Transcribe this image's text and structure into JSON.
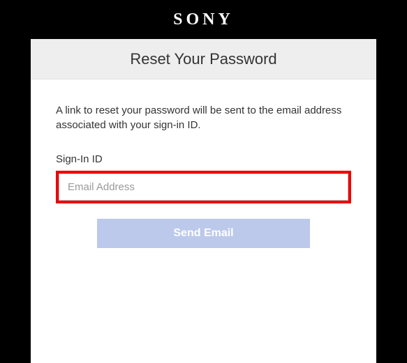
{
  "header": {
    "logo": "SONY"
  },
  "titleBar": {
    "title": "Reset Your Password"
  },
  "content": {
    "description": "A link to reset your password will be sent to the email address associated with your sign-in ID.",
    "fieldLabel": "Sign-In ID",
    "emailPlaceholder": "Email Address",
    "buttonLabel": "Send Email"
  }
}
